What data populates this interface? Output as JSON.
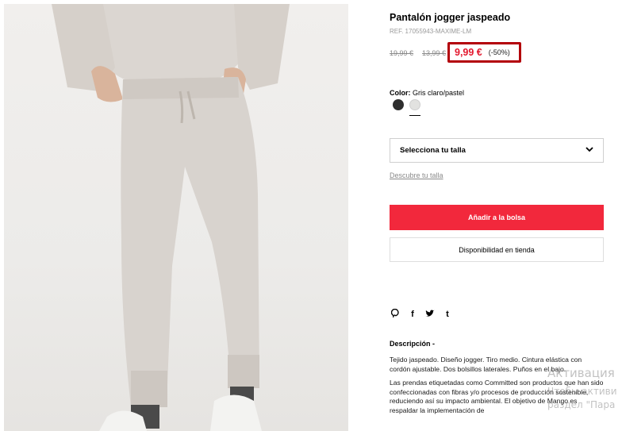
{
  "product": {
    "title": "Pantalón jogger jaspeado",
    "ref": "REF. 17055943-MAXIME-LM",
    "image_alt": "Pantalón jogger jaspeado gris claro"
  },
  "pricing": {
    "original_price": "19,99 €",
    "previous_price": "13,99 €",
    "current_price": "9,99 €",
    "discount": "(-50%)",
    "highlight_color": "#b3000a",
    "price_color": "#e3172d"
  },
  "color": {
    "label": "Color:",
    "selected_name": "Gris claro/pastel",
    "swatches": [
      {
        "name": "dark-grey",
        "hex": "#2e2e2e"
      },
      {
        "name": "light-grey",
        "hex": "#e2e2e0",
        "selected": true
      }
    ]
  },
  "size": {
    "select_label": "Selecciona tu talla",
    "guide_link": "Descubre tu talla"
  },
  "actions": {
    "add_to_bag": "Añadir a la bolsa",
    "store_availability": "Disponibilidad en tienda",
    "accent": "#f2283c"
  },
  "social": [
    {
      "name": "pinterest-icon",
      "glyph": "P"
    },
    {
      "name": "facebook-icon",
      "glyph": "f"
    },
    {
      "name": "twitter-icon",
      "glyph": "t"
    },
    {
      "name": "tumblr-icon",
      "glyph": "t"
    }
  ],
  "description": {
    "heading": "Descripción -",
    "paragraph_1": "Tejido jaspeado. Diseño jogger. Tiro medio. Cintura elástica con cordón ajustable. Dos bolsillos laterales. Puños en el bajo.",
    "paragraph_2": "Las prendas etiquetadas como Committed son productos que han sido confeccionadas con fibras y/o procesos de producción sostenible, reduciendo así su impacto ambiental. El objetivo de Mango es respaldar la implementación de"
  },
  "os_watermark": {
    "line1": "Активация",
    "line2": "Чтобы активи",
    "line3": "раздел \"Пара"
  }
}
